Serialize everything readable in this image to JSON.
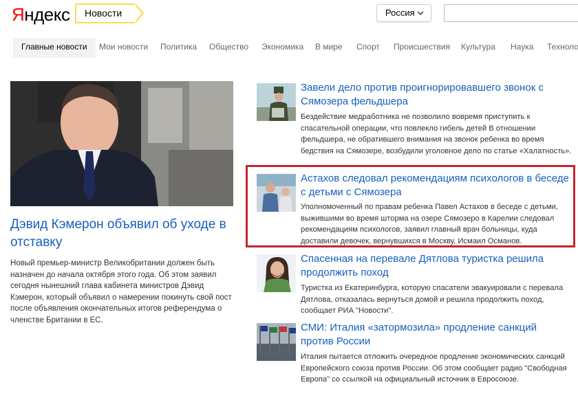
{
  "header": {
    "logo_ya": "Я",
    "logo_rest": "ндекс",
    "service": "Новости",
    "region": "Россия"
  },
  "nav": {
    "items": [
      {
        "label": "Главные новости"
      },
      {
        "label": "Мои новости"
      },
      {
        "label": "Политика"
      },
      {
        "label": "Общество"
      },
      {
        "label": "Экономика"
      },
      {
        "label": "В мире"
      },
      {
        "label": "Спорт"
      },
      {
        "label": "Происшествия"
      },
      {
        "label": "Культура"
      },
      {
        "label": "Наука"
      },
      {
        "label": "Техноло"
      }
    ]
  },
  "main_story": {
    "title": "Дэвид Кэмерон объявил об уходе в отставку",
    "text": "Новый премьер-министр Великобритании должен быть назначен до начала октября этого года. Об этом заявил сегодня нынешний глава кабинета министров Дэвид Кэмерон, который объявил о намерении покинуть свой пост после объявления окончательных итогов референдума о членстве Британии в ЕС."
  },
  "stories": [
    {
      "title": "Завели дело против проигнорировавшего звонок с Сямозера фельдшера",
      "text": "Бездействие медработника не позволило вовремя приступить к спасательной операции, что повлекло гибель детей В отношении фельдшера, не обратившего внимания на звонок ребенка во время бедствия на Сямозере, возбудили уголовное дело по статье «Халатность»."
    },
    {
      "title": "Астахов следовал рекомендациям психологов в беседе с детьми с Сямозера",
      "text": "Уполномоченный по правам ребенка Павел Астахов в беседе с детьми, выжившими во время шторма на озере Сямозеро в Карелии следовал рекомендациям психологов, заявил главный врач больницы, куда доставили девочек, вернувшихся в Москву, Исмаил Османов."
    },
    {
      "title": "Спасенная на перевале Дятлова туристка решила продолжить поход",
      "text": "Туристка из Екатеринбурга, которую спасатели эвакуировали с перевала Дятлова, отказалась вернуться домой и решила продолжить поход, сообщает РИА \"Новости\"."
    },
    {
      "title": "СМИ: Италия «затормозила» продление санкций против России",
      "text": "Италия пытается отложить очередное продление экономических санкций Европейского союза против России. Об этом сообщает радио \"Свободная Европа\" со ссылкой на официальный источник в Евросоюзе."
    }
  ],
  "icons": {
    "region_dropdown": "chevron-down-icon"
  },
  "colors": {
    "link": "#1560bd",
    "logo_red": "#ff0000",
    "service_border": "#ffdb4d",
    "highlight": "#c0262f"
  }
}
